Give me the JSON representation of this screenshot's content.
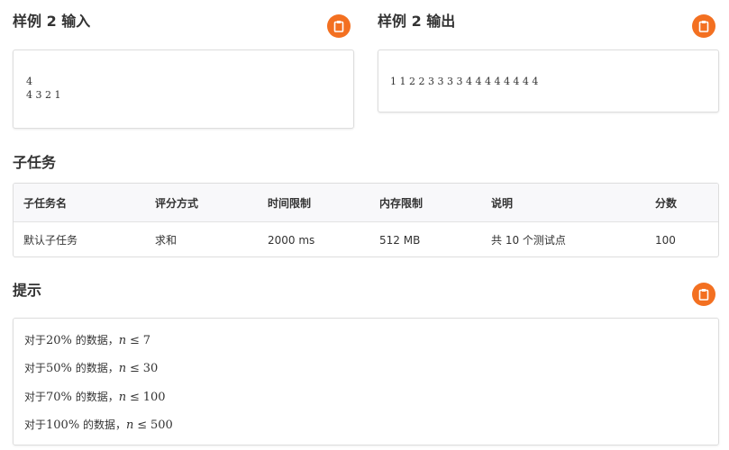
{
  "sample_input": {
    "title": "样例 2 输入",
    "lines": [
      "4",
      "4 3 2 1"
    ]
  },
  "sample_output": {
    "title": "样例 2 输出",
    "lines": [
      "1 1 2 2 3 3 3 3 4 4 4 4 4 4 4 4"
    ]
  },
  "subtasks": {
    "title": "子任务",
    "headers": [
      "子任务名",
      "评分方式",
      "时间限制",
      "内存限制",
      "说明",
      "分数"
    ],
    "rows": [
      [
        "默认子任务",
        "求和",
        "2000 ms",
        "512 MB",
        "共 10 个测试点",
        "100"
      ]
    ]
  },
  "hint": {
    "title": "提示",
    "lines": [
      {
        "prefix": "对于",
        "pct": "20%",
        "mid": "的数据，",
        "var": "n",
        "op": "≤",
        "value": "7"
      },
      {
        "prefix": "对于",
        "pct": "50%",
        "mid": "的数据，",
        "var": "n",
        "op": "≤",
        "value": "30"
      },
      {
        "prefix": "对于",
        "pct": "70%",
        "mid": "的数据，",
        "var": "n",
        "op": "≤",
        "value": "100"
      },
      {
        "prefix": "对于",
        "pct": "100%",
        "mid": "的数据，",
        "var": "n",
        "op": "≤",
        "value": "500"
      }
    ]
  },
  "icons": {
    "copy": "clipboard-icon"
  },
  "colors": {
    "accent": "#f37021",
    "border": "#dddddd",
    "header_bg": "#f8f8fa",
    "text": "#333333"
  }
}
